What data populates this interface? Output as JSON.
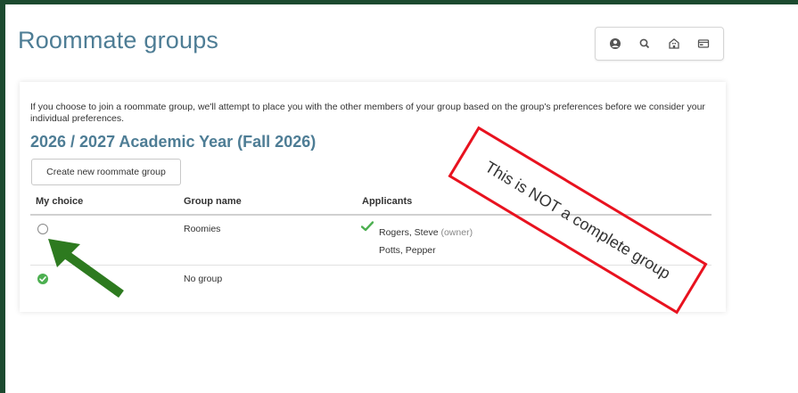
{
  "page": {
    "title": "Roommate groups"
  },
  "toolbar": {
    "icons": [
      "user-icon",
      "search-icon",
      "building-icon",
      "card-icon"
    ]
  },
  "card": {
    "intro": "If you choose to join a roommate group, we'll attempt to place you with the other members of your group based on the group's preferences before we consider your individual preferences.",
    "year_heading": "2026 / 2027 Academic Year (Fall 2026)",
    "create_button": "Create new roommate group"
  },
  "table": {
    "headers": [
      "My choice",
      "Group name",
      "Applicants"
    ],
    "rows": [
      {
        "selected": false,
        "group_name": "Roomies",
        "applicants": [
          {
            "name": "Rogers, Steve",
            "tag": "(owner)",
            "confirmed": true
          },
          {
            "name": "Potts, Pepper",
            "tag": "",
            "confirmed": false
          }
        ]
      },
      {
        "selected": true,
        "group_name": "No group",
        "applicants": []
      }
    ]
  },
  "annotation": {
    "text": "This is NOT a complete group",
    "box_color": "#e8121f",
    "arrow_color": "#2d7a1f"
  },
  "colors": {
    "title": "#4e7d95",
    "frame": "#1c4a2f",
    "check": "#4caf50"
  }
}
